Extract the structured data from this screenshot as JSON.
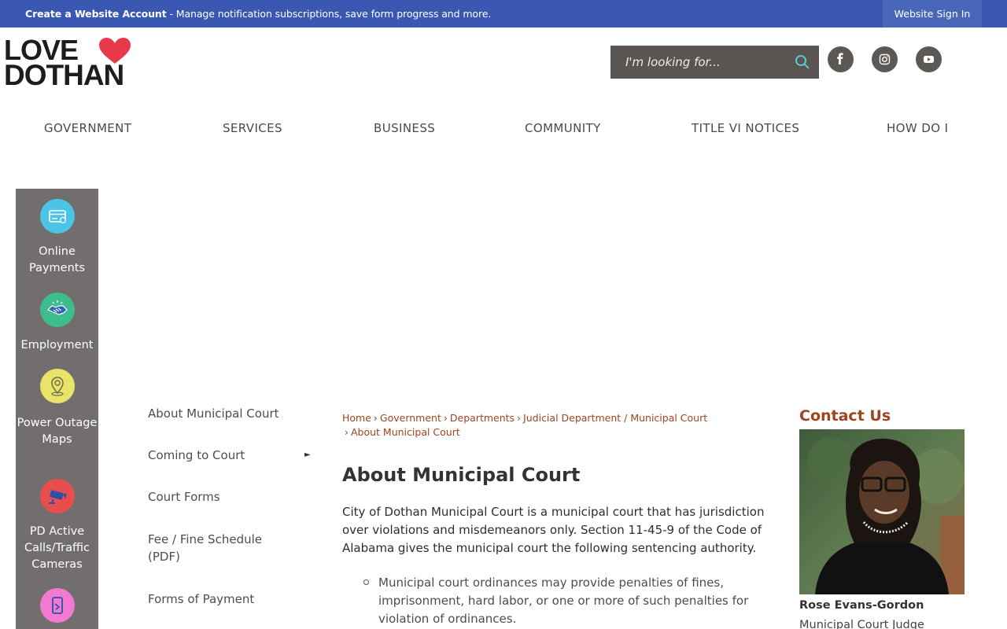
{
  "topbar": {
    "create_account": "Create a Website Account",
    "message": " - Manage notification subscriptions, save form progress and more.",
    "sign_in": "Website Sign In"
  },
  "logo": {
    "line1": "LOVE",
    "line2": "DOTHAN",
    "heart_color": "#e8394a"
  },
  "search": {
    "placeholder": "I'm looking for..."
  },
  "social": [
    "facebook-icon",
    "instagram-icon",
    "youtube-icon"
  ],
  "nav": {
    "items": [
      "GOVERNMENT",
      "SERVICES",
      "BUSINESS",
      "COMMUNITY",
      "TITLE VI NOTICES",
      "HOW DO I"
    ]
  },
  "quick_links": [
    {
      "label": "Online Payments",
      "icon": "payment-card-icon",
      "color": "#4cc4e6"
    },
    {
      "label": "Employment",
      "icon": "handshake-icon",
      "color": "#3dbd8e"
    },
    {
      "label": "Power Outage Maps",
      "icon": "map-pin-icon",
      "color": "#e9e36a"
    },
    {
      "label": "PD Active Calls/Traffic Cameras",
      "icon": "camera-icon",
      "color": "#e94e4e"
    },
    {
      "label": "",
      "icon": "mobile-icon",
      "color": "#f07ad0"
    }
  ],
  "sidenav": {
    "items": [
      "About Municipal Court",
      "Coming to Court",
      "Court Forms",
      "Fee / Fine Schedule (PDF)",
      "Forms of Payment"
    ]
  },
  "breadcrumb": [
    "Home",
    "Government",
    "Departments",
    "Judicial Department / Municipal Court",
    "About Municipal Court"
  ],
  "content": {
    "title": "About Municipal Court",
    "paragraph": "City of Dothan Municipal Court is a municipal court that has jurisdiction over violations and misdemeanors only. Section 11-45-9 of the Code of Alabama gives the municipal court the following sentencing authority.",
    "bullet": "Municipal court ordinances may provide penalties of fines, imprisonment, hard labor, or one or more of such penalties for violation of ordinances."
  },
  "contact": {
    "title": "Contact Us",
    "name": "Rose Evans-Gordon",
    "role": "Municipal Court Judge"
  },
  "colors": {
    "topbar": "#3a58b1",
    "sidebar": "#716e6d",
    "accent": "#a0431f"
  }
}
